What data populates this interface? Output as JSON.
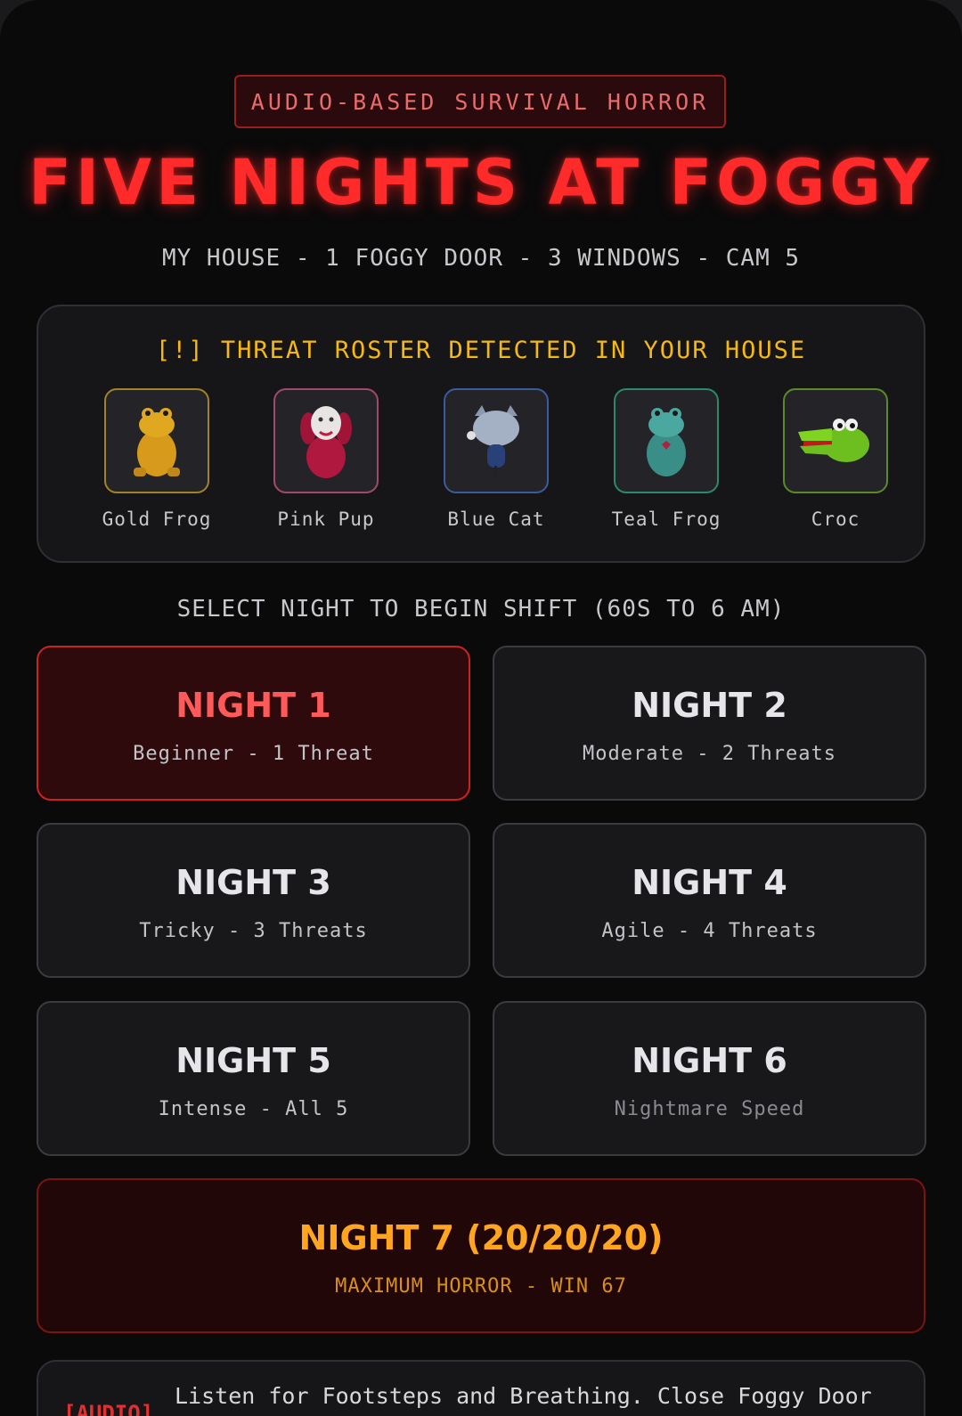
{
  "header": {
    "tag": "AUDIO-BASED SURVIVAL HORROR",
    "title": "FIVE NIGHTS AT FOGGY",
    "subtitle": "MY HOUSE - 1 FOGGY DOOR - 3 WINDOWS - CAM 5"
  },
  "roster": {
    "title": "[!] THREAT ROSTER DETECTED IN YOUR HOUSE",
    "characters": [
      {
        "name": "Gold Frog",
        "border": "#a0822a",
        "color": "#e0a820"
      },
      {
        "name": "Pink Pup",
        "border": "#a04a6a",
        "color": "#c0204a"
      },
      {
        "name": "Blue Cat",
        "border": "#3a5c9a",
        "color": "#9aa8c0"
      },
      {
        "name": "Teal Frog",
        "border": "#2a8a6a",
        "color": "#4aa8a0"
      },
      {
        "name": "Croc",
        "border": "#5a8a2a",
        "color": "#7ed420"
      }
    ]
  },
  "select_label": "SELECT NIGHT TO BEGIN SHIFT (60S TO 6 AM)",
  "nights": [
    {
      "label": "NIGHT 1",
      "desc": "Beginner - 1 Threat"
    },
    {
      "label": "NIGHT 2",
      "desc": "Moderate - 2 Threats"
    },
    {
      "label": "NIGHT 3",
      "desc": "Tricky - 3 Threats"
    },
    {
      "label": "NIGHT 4",
      "desc": "Agile - 4 Threats"
    },
    {
      "label": "NIGHT 5",
      "desc": "Intense - All 5"
    },
    {
      "label": "NIGHT 6",
      "desc": "Nightmare Speed"
    },
    {
      "label": "NIGHT 7 (20/20/20)",
      "desc": "MAXIMUM HORROR - WIN 67"
    }
  ],
  "tip": {
    "tag": "[AUDIO]",
    "text": "Listen for Footsteps and Breathing. Close Foggy Door"
  },
  "colors": {
    "accent_red": "#ff2a2a",
    "warning_yellow": "#f5b815",
    "final_orange": "#ffa51f"
  }
}
